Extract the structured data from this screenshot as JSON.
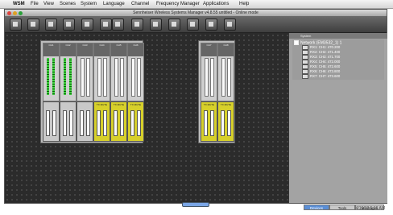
{
  "menubar": {
    "apple_symbol": "",
    "items": [
      "WSM",
      "File",
      "View",
      "Scenes",
      "System",
      "Language",
      "Channel",
      "Frequency Manager",
      "Applications",
      "Help"
    ]
  },
  "window": {
    "title": "Sennheiser Wireless Systems Manager v4.8.55 untitled - Online mode"
  },
  "toolbar": {
    "icons": [
      "new-icon",
      "open-icon",
      "save-icon",
      "device-icon",
      "network-icon",
      "monitor-icon",
      "scan-icon",
      "frequency-icon",
      "zoom-out-icon",
      "zoom-in-icon",
      "grid-icon",
      "lock-icon",
      "help-icon"
    ]
  },
  "racks": {
    "left": {
      "top_channels": [
        {
          "name": "CH1"
        },
        {
          "name": "CH2"
        },
        {
          "name": "CH3"
        },
        {
          "name": "CH4"
        },
        {
          "name": "CH5"
        },
        {
          "name": "CH6"
        }
      ],
      "bottom_channels": [
        {
          "label": "",
          "state": "active"
        },
        {
          "label": "",
          "state": "active"
        },
        {
          "label": "",
          "state": "active"
        },
        {
          "label": "TX MUTE",
          "state": "mute"
        },
        {
          "label": "TX MUTE",
          "state": "mute"
        },
        {
          "label": "TX MUTE",
          "state": "mute"
        }
      ]
    },
    "right": {
      "top_channels": [
        {
          "name": "CH7"
        },
        {
          "name": "CH8"
        }
      ],
      "bottom_channels": [
        {
          "label": "TX MUTE",
          "state": "mute"
        },
        {
          "label": "TX MUTE",
          "state": "mute"
        }
      ]
    }
  },
  "sidebar": {
    "header": "System",
    "root": "Network (EM3532_1) 1",
    "children": [
      "RX1: CH1: 470.200",
      "RX2: CH2: 471.400",
      "RX3: CH3: 471.700",
      "RX4: CH4: 472.000",
      "RX5: CH5: 472.600",
      "RX6: CH6: 473.800",
      "RX7: CH7: 473.600"
    ],
    "tabs": [
      {
        "label": "Devices",
        "active": true
      },
      {
        "label": "Tools",
        "active": false
      },
      {
        "label": "Messages",
        "active": false
      }
    ]
  },
  "status": {
    "timestamp": "4/16/13  5:16 AM"
  }
}
